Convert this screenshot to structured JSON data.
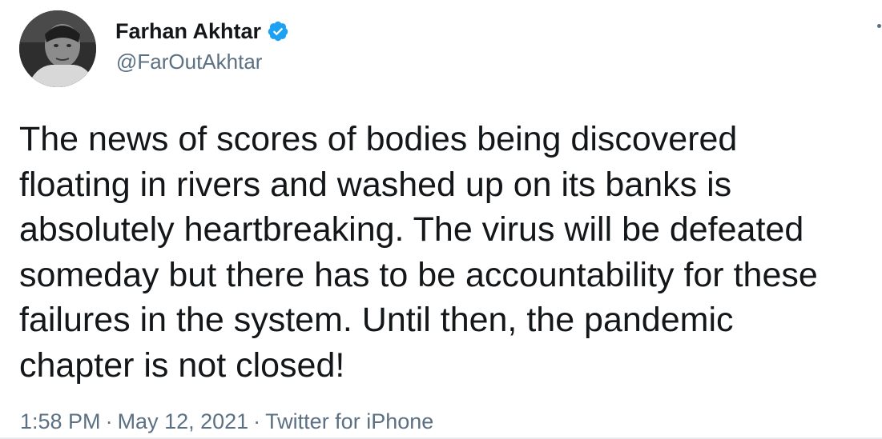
{
  "author": {
    "display_name": "Farhan Akhtar",
    "handle": "@FarOutAkhtar",
    "verified": true
  },
  "tweet": {
    "lines": [
      "The news of scores of bodies being discovered",
      "floating in rivers and washed up on its banks is",
      "absolutely heartbreaking. The virus will be defeated",
      "someday but there has to be accountability for these",
      "failures in the system. Until then, the pandemic",
      "chapter is not closed!"
    ]
  },
  "meta": {
    "time": "1:58 PM",
    "separator": "·",
    "date": "May 12, 2021",
    "source": "Twitter for iPhone"
  },
  "icons": {
    "verified": "verified-badge-icon",
    "more": "more-options-icon"
  },
  "colors": {
    "verified": "#1da1f2",
    "text": "#14171a",
    "secondary": "#5b7083"
  }
}
